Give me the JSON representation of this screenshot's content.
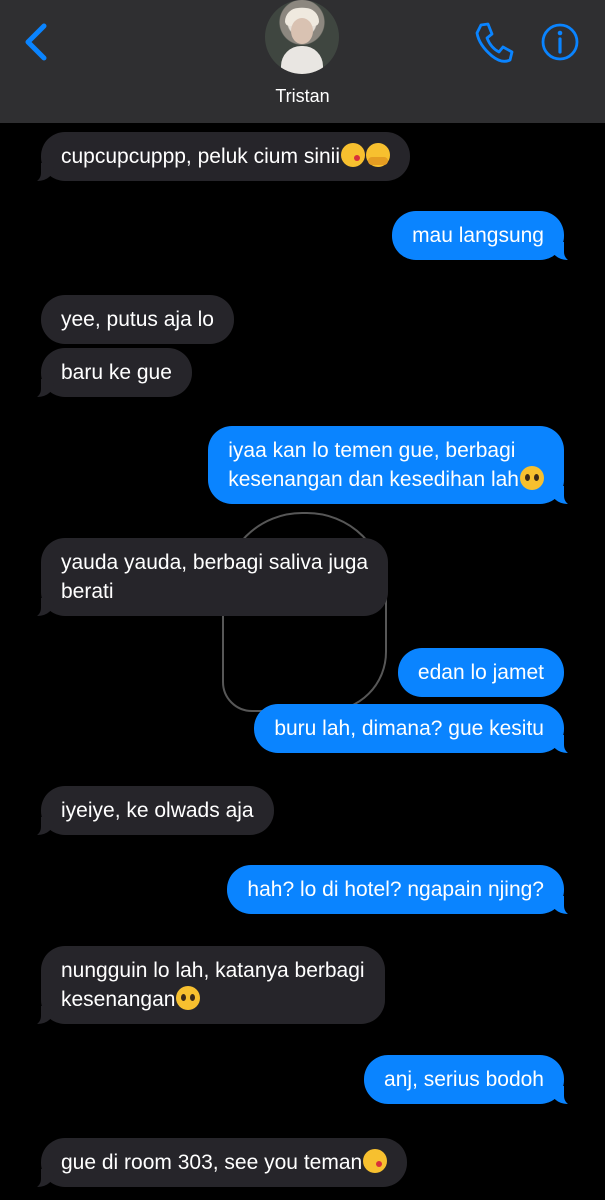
{
  "contact": {
    "name": "Tristan"
  },
  "icons": {
    "back": "chevron-left-icon",
    "call": "phone-icon",
    "info": "info-icon",
    "accent": "#0a84ff"
  },
  "colors": {
    "incoming_bubble": "#26252a",
    "outgoing_bubble": "#0a84ff",
    "header": "#2f2f31"
  },
  "messages": [
    {
      "from": "them",
      "text": "cupcupcuppp, peluk cium sinii",
      "emoji": [
        "kiss",
        "hug"
      ]
    },
    {
      "from": "me",
      "text": "mau langsung"
    },
    {
      "from": "them",
      "text": "yee, putus aja lo"
    },
    {
      "from": "them",
      "text": "baru ke gue"
    },
    {
      "from": "me",
      "line1": "iyaa kan lo temen gue, berbagi",
      "line2": "kesenangan dan kesedihan lah",
      "emoji": [
        "pleading"
      ]
    },
    {
      "from": "them",
      "line1": "yauda yauda, berbagi saliva juga",
      "line2": "berati"
    },
    {
      "from": "me",
      "text": "edan lo jamet"
    },
    {
      "from": "me",
      "text": "buru lah, dimana? gue kesitu"
    },
    {
      "from": "them",
      "text": "iyeiye, ke olwads aja"
    },
    {
      "from": "me",
      "text": "hah? lo di hotel? ngapain njing?"
    },
    {
      "from": "them",
      "line1": "nungguin lo lah, katanya berbagi",
      "line2": "kesenangan",
      "emoji": [
        "pleading"
      ]
    },
    {
      "from": "me",
      "text": "anj, serius bodoh"
    },
    {
      "from": "them",
      "text": "gue di room 303, see you teman",
      "emoji": [
        "kiss"
      ]
    }
  ]
}
